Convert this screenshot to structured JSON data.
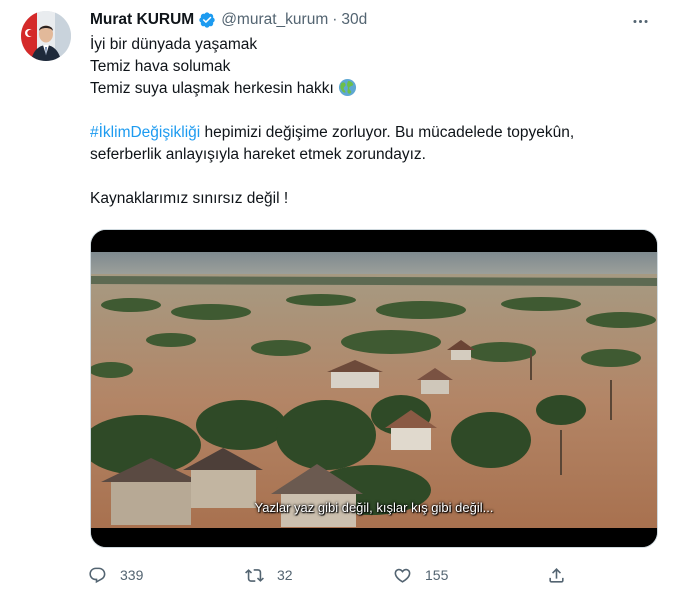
{
  "tweet": {
    "display_name": "Murat KURUM",
    "handle": "@murat_kurum",
    "separator": "·",
    "time": "30d",
    "lines": [
      "İyi bir dünyada yaşamak",
      "Temiz hava solumak",
      "Temiz suya ulaşmak herkesin hakkı"
    ],
    "hashtag": "#İklimDeğişikliği",
    "paragraph_rest": " hepimizi değişime zorluyor. Bu mücadelede topyekûn,",
    "paragraph_line2": "seferberlik anlayışıyla hareket etmek zorundayız.",
    "closing": "Kaynaklarımız sınırsız değil !",
    "media_subtitle": "Yazlar yaz gibi değil, kışlar kış gibi değil..."
  },
  "icons": {
    "verified": "verified-badge-icon",
    "more": "more-dots-icon",
    "globe": "globe-emoji-icon",
    "reply": "reply-icon",
    "retweet": "retweet-icon",
    "like": "like-heart-icon",
    "share": "share-icon"
  },
  "actions": {
    "reply_count": "339",
    "retweet_count": "32",
    "like_count": "155"
  },
  "colors": {
    "accent": "#1d9bf0",
    "text": "#0f1419",
    "muted": "#536471"
  }
}
